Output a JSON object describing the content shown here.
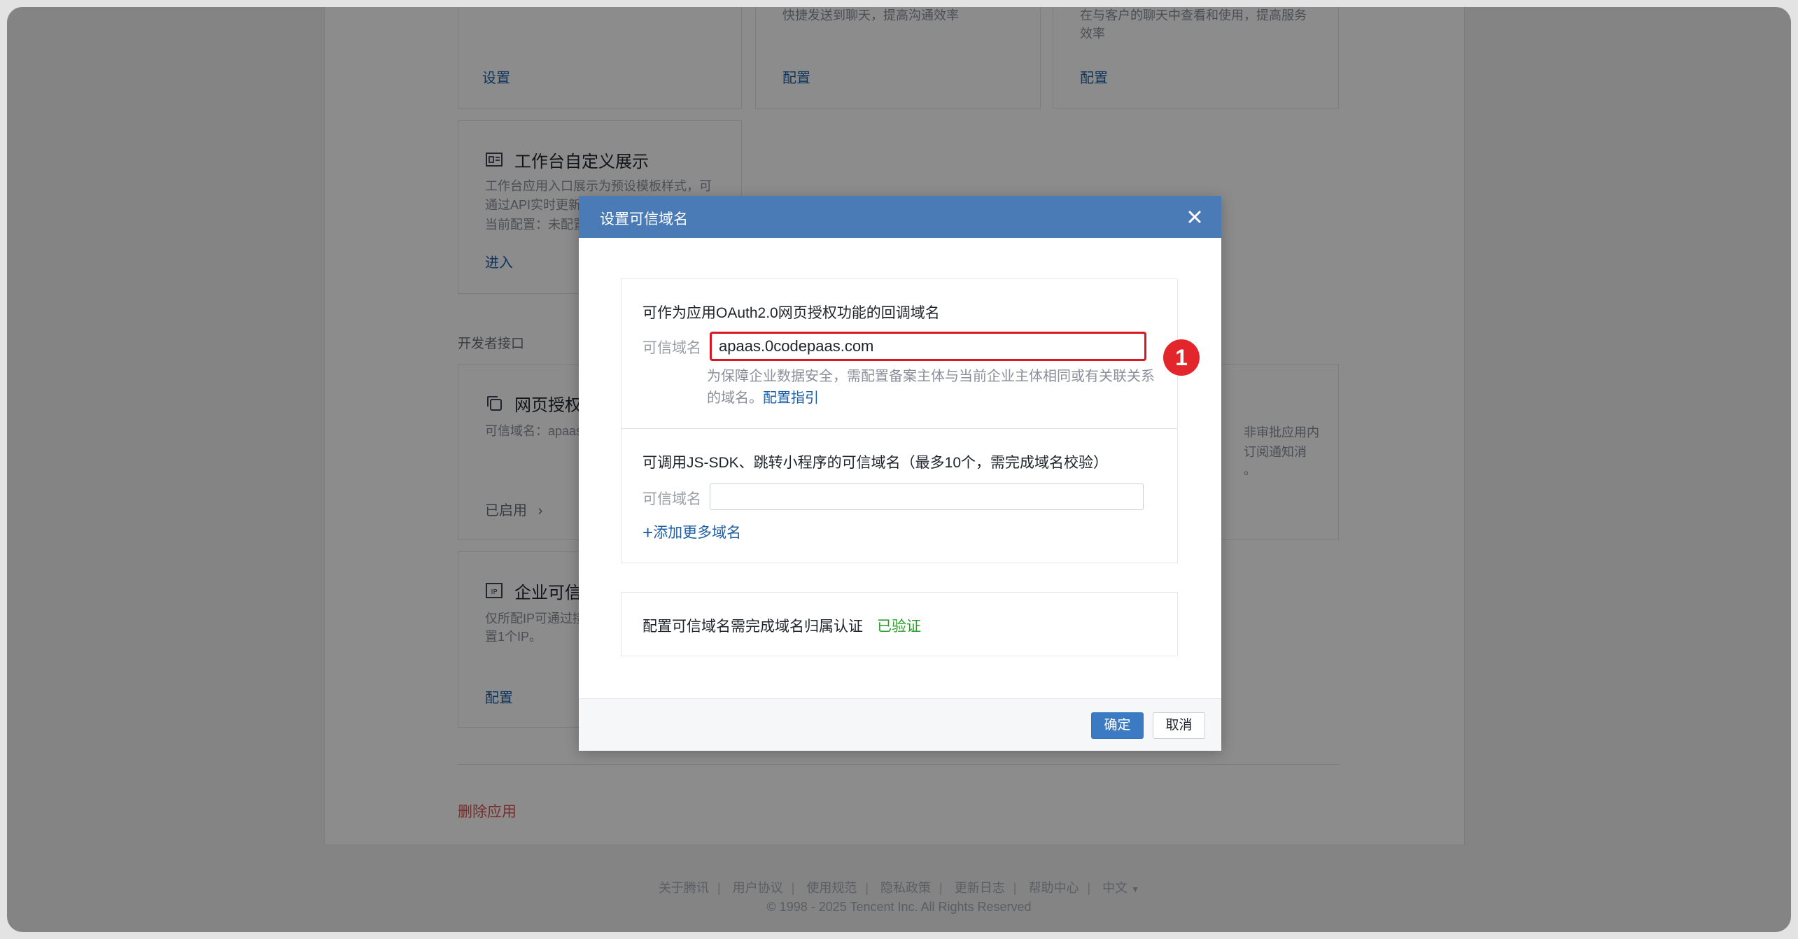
{
  "background": {
    "top_cards": [
      {
        "desc": "快捷发送到聊天，提高沟通效率",
        "link": "设置"
      },
      {
        "desc": "快捷发送到聊天，提高沟通效率",
        "link": "配置"
      },
      {
        "desc": "在与客户的聊天中查看和使用，提高服务效率",
        "link": "配置"
      }
    ],
    "top_card_1_link": "设置",
    "top_card_2_desc": "快捷发送到聊天，提高沟通效率",
    "top_card_2_link": "配置",
    "top_card_3_desc_1": "在与客户的聊天中查看和使用，提高服务",
    "top_card_3_desc_2": "效率",
    "top_card_3_link": "配置",
    "workbench_card": {
      "title": "工作台自定义展示",
      "desc_1": "工作台应用入口展示为预设模板样式，可",
      "desc_2": "通过API实时更新",
      "current": "当前配置：未配置",
      "link": "进入"
    },
    "section_dev_api": "开发者接口",
    "oauth_card": {
      "title": "网页授权及",
      "desc": "可信域名：apaas.",
      "status": "已启用"
    },
    "right_card": {
      "desc_1": "非审批应用内",
      "desc_2": "订阅通知消",
      "desc_3": "。"
    },
    "ip_card": {
      "title": "企业可信I",
      "desc_1": "仅所配IP可通过接",
      "desc_2": "置1个IP。",
      "link": "配置"
    },
    "delete_app": "删除应用",
    "footer_links": [
      "关于腾讯",
      "用户协议",
      "使用规范",
      "隐私政策",
      "更新日志",
      "帮助中心",
      "中文"
    ],
    "copyright": "© 1998 - 2025 Tencent Inc. All Rights Reserved"
  },
  "modal": {
    "title": "设置可信域名",
    "oauth_section": {
      "title": "可作为应用OAuth2.0网页授权功能的回调域名",
      "label": "可信域名",
      "value": "apaas.0codepaas.com",
      "hint_line1": "为保障企业数据安全，需配置备案主体与当前企业主体相同或有关联关系",
      "hint_line2": "的域名。",
      "hint_link": "配置指引"
    },
    "jssdk_section": {
      "title": "可调用JS-SDK、跳转小程序的可信域名（最多10个，需完成域名校验）",
      "label": "可信域名",
      "value": "",
      "add_more": "添加更多域名"
    },
    "verify_section": {
      "text": "配置可信域名需完成域名归属认证",
      "status": "已验证"
    },
    "confirm": "确定",
    "cancel": "取消"
  },
  "annotation_badge": "1",
  "colors": {
    "modal_header": "#4a7bb7",
    "link": "#1d5fa6",
    "verified": "#2aa12a",
    "highlight": "#d9191f",
    "danger": "#d9534f"
  }
}
